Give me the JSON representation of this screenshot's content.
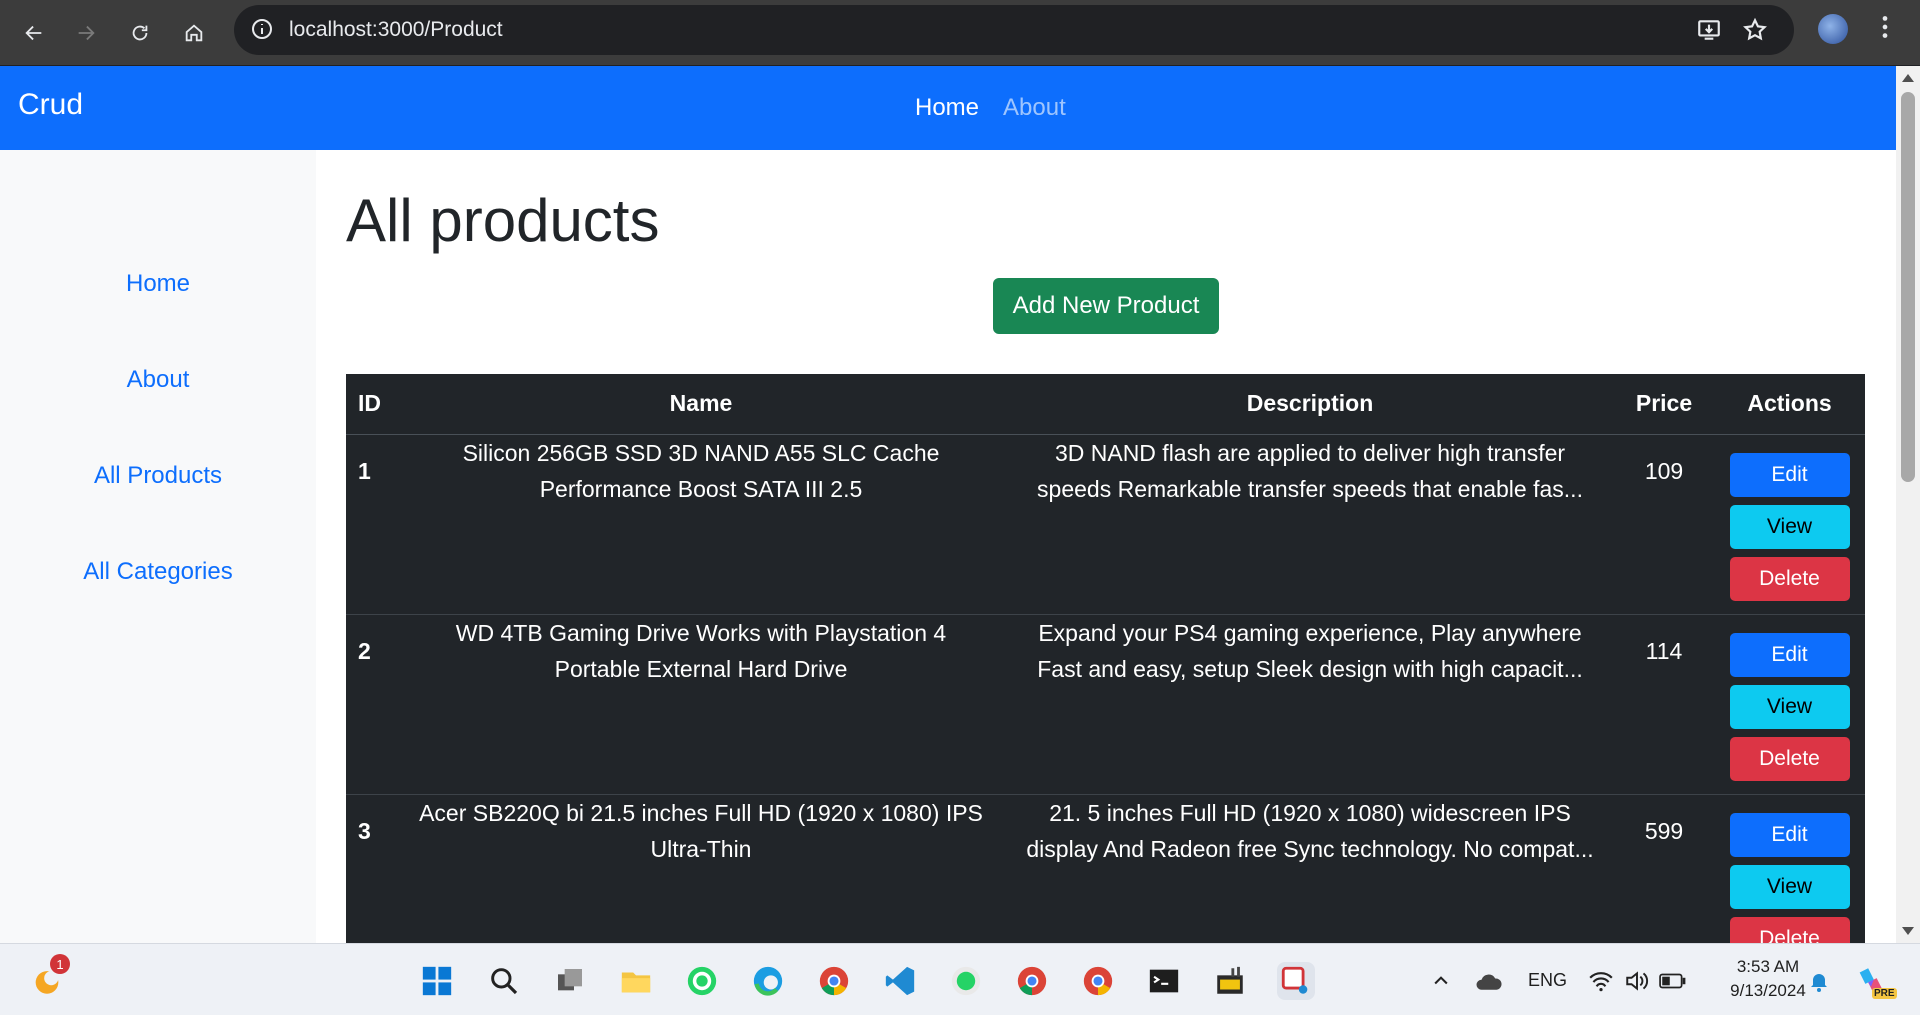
{
  "browser": {
    "url": "localhost:3000/Product",
    "icons": [
      "back-icon",
      "forward-icon",
      "reload-icon",
      "home-icon",
      "site-info-icon",
      "install-app-icon",
      "bookmark-star-icon",
      "profile-avatar",
      "more-menu-icon"
    ]
  },
  "navbar": {
    "brand": "Crud",
    "links": [
      {
        "label": "Home",
        "active": true
      },
      {
        "label": "About",
        "active": false
      }
    ]
  },
  "sidebar": {
    "items": [
      "Home",
      "About",
      "All Products",
      "All Categories"
    ]
  },
  "main": {
    "title": "All products",
    "add_button": "Add New Product",
    "table": {
      "headers": [
        "ID",
        "Name",
        "Description",
        "Price",
        "Actions"
      ],
      "rows": [
        {
          "id": "1",
          "name": "Silicon 256GB SSD 3D NAND A55 SLC Cache Performance Boost SATA III 2.5",
          "description": "3D NAND flash are applied to deliver high transfer speeds Remarkable transfer speeds that enable fas...",
          "price": "109"
        },
        {
          "id": "2",
          "name": "WD 4TB Gaming Drive Works with Playstation 4 Portable External Hard Drive",
          "description": "Expand your PS4 gaming experience, Play anywhere Fast and easy, setup Sleek design with high capacit...",
          "price": "114"
        },
        {
          "id": "3",
          "name": "Acer SB220Q bi 21.5 inches Full HD (1920 x 1080) IPS Ultra-Thin",
          "description": "21. 5 inches Full HD (1920 x 1080) widescreen IPS display And Radeon free Sync technology. No compat...",
          "price": "599"
        }
      ],
      "actions": {
        "edit": "Edit",
        "view": "View",
        "delete": "Delete"
      }
    }
  },
  "taskbar": {
    "widget_badge": "1",
    "language": "ENG",
    "time": "3:53 AM",
    "date": "9/13/2024",
    "copilot_badge": "PRE"
  },
  "colors": {
    "primary": "#0d6efd",
    "success": "#198754",
    "info": "#0dcaf0",
    "danger": "#dc3545",
    "table_dark": "#212529"
  }
}
